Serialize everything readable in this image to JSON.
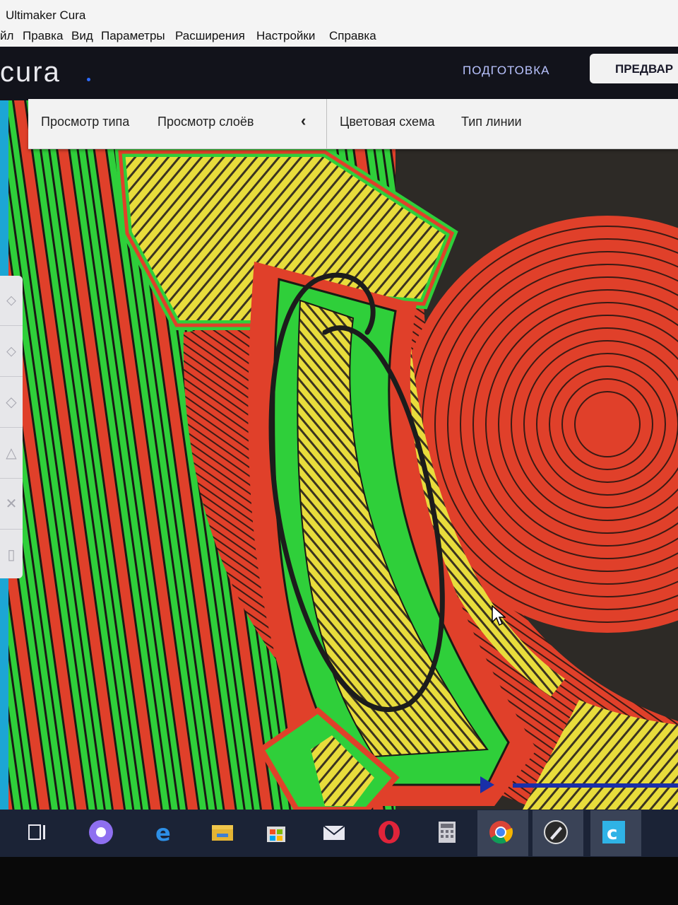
{
  "window": {
    "title": "Ultimaker Cura"
  },
  "menu": [
    "йл",
    "Правка",
    "Вид",
    "Параметры",
    "Расширения",
    "Настройки",
    "Справка"
  ],
  "header": {
    "logo": "cura",
    "stage_prepare": "ПОДГОТОВКА",
    "stage_preview": "ПРЕДВАР"
  },
  "toolbar": {
    "view_type": "Просмотр типа",
    "view_layers": "Просмотр слоёв",
    "color_scheme": "Цветовая схема",
    "line_type": "Тип линии"
  },
  "colors": {
    "wall_outer": "#e0402a",
    "wall_inner": "#2fcf3a",
    "skin": "#e8dc3c",
    "accent": "#1a2fa8"
  },
  "taskbar": {
    "icons": [
      "task-view-icon",
      "alice-icon",
      "edge-icon",
      "explorer-icon",
      "store-icon",
      "mail-icon",
      "opera-icon",
      "calculator-icon",
      "chrome-icon",
      "inkscape-icon",
      "cura-icon"
    ]
  }
}
